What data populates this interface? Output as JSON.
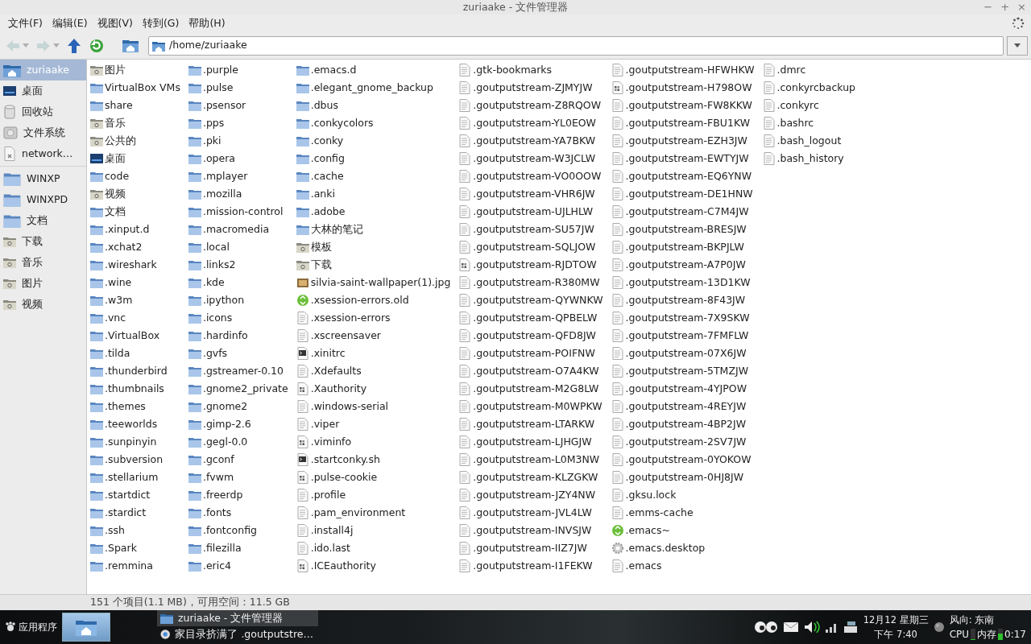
{
  "window": {
    "title": "zuriaake - 文件管理器",
    "controls": [
      "−",
      "+",
      "×"
    ]
  },
  "menu": [
    "文件(F)",
    "编辑(E)",
    "视图(V)",
    "转到(G)",
    "帮助(H)"
  ],
  "toolbar": [
    {
      "kind": "back",
      "disabled": true
    },
    {
      "kind": "forward",
      "disabled": true
    },
    {
      "kind": "up",
      "disabled": false
    },
    {
      "kind": "reload",
      "disabled": false
    },
    {
      "kind": "home",
      "disabled": false
    }
  ],
  "location": {
    "value": "/home/zuriaake"
  },
  "sidebar": {
    "groups": [
      [
        {
          "label": "zuriaake",
          "kind": "home",
          "selected": true
        },
        {
          "label": "桌面",
          "kind": "desktop",
          "selected": false
        },
        {
          "label": "回收站",
          "kind": "trash",
          "selected": false
        },
        {
          "label": "文件系统",
          "kind": "drive",
          "selected": false
        },
        {
          "label": "network…",
          "kind": "network",
          "selected": false
        }
      ],
      [
        {
          "label": "WINXP",
          "kind": "folder",
          "selected": false
        },
        {
          "label": "WINXPD",
          "kind": "folder",
          "selected": false
        },
        {
          "label": "文档",
          "kind": "folder",
          "selected": false
        },
        {
          "label": "下载",
          "kind": "special",
          "selected": false
        },
        {
          "label": "音乐",
          "kind": "special",
          "selected": false
        },
        {
          "label": "图片",
          "kind": "special",
          "selected": false
        },
        {
          "label": "视频",
          "kind": "special",
          "selected": false
        }
      ]
    ]
  },
  "files": [
    {
      "name": "图片",
      "kind": "special"
    },
    {
      "name": "VirtualBox VMs",
      "kind": "folder"
    },
    {
      "name": "share",
      "kind": "folder"
    },
    {
      "name": "音乐",
      "kind": "special"
    },
    {
      "name": "公共的",
      "kind": "special"
    },
    {
      "name": "桌面",
      "kind": "desktop"
    },
    {
      "name": "code",
      "kind": "folder"
    },
    {
      "name": "视频",
      "kind": "special"
    },
    {
      "name": "文档",
      "kind": "folder"
    },
    {
      "name": ".xinput.d",
      "kind": "folder"
    },
    {
      "name": ".xchat2",
      "kind": "folder"
    },
    {
      "name": ".wireshark",
      "kind": "folder"
    },
    {
      "name": ".wine",
      "kind": "folder"
    },
    {
      "name": ".w3m",
      "kind": "folder"
    },
    {
      "name": ".vnc",
      "kind": "folder"
    },
    {
      "name": ".VirtualBox",
      "kind": "folder"
    },
    {
      "name": ".tilda",
      "kind": "folder"
    },
    {
      "name": ".thunderbird",
      "kind": "folder"
    },
    {
      "name": ".thumbnails",
      "kind": "folder"
    },
    {
      "name": ".themes",
      "kind": "folder"
    },
    {
      "name": ".teeworlds",
      "kind": "folder"
    },
    {
      "name": ".sunpinyin",
      "kind": "folder"
    },
    {
      "name": ".subversion",
      "kind": "folder"
    },
    {
      "name": ".stellarium",
      "kind": "folder"
    },
    {
      "name": ".startdict",
      "kind": "folder"
    },
    {
      "name": ".stardict",
      "kind": "folder"
    },
    {
      "name": ".ssh",
      "kind": "folder"
    },
    {
      "name": ".Spark",
      "kind": "folder"
    },
    {
      "name": ".remmina",
      "kind": "folder"
    },
    {
      "name": ".purple",
      "kind": "folder"
    },
    {
      "name": ".pulse",
      "kind": "folder"
    },
    {
      "name": ".psensor",
      "kind": "folder"
    },
    {
      "name": ".pps",
      "kind": "folder"
    },
    {
      "name": ".pki",
      "kind": "folder"
    },
    {
      "name": ".opera",
      "kind": "folder"
    },
    {
      "name": ".mplayer",
      "kind": "folder"
    },
    {
      "name": ".mozilla",
      "kind": "folder"
    },
    {
      "name": ".mission-control",
      "kind": "folder"
    },
    {
      "name": ".macromedia",
      "kind": "folder"
    },
    {
      "name": ".local",
      "kind": "folder"
    },
    {
      "name": ".links2",
      "kind": "folder"
    },
    {
      "name": ".kde",
      "kind": "folder"
    },
    {
      "name": ".ipython",
      "kind": "folder"
    },
    {
      "name": ".icons",
      "kind": "folder"
    },
    {
      "name": ".hardinfo",
      "kind": "folder"
    },
    {
      "name": ".gvfs",
      "kind": "folder"
    },
    {
      "name": ".gstreamer-0.10",
      "kind": "folder"
    },
    {
      "name": ".gnome2_private",
      "kind": "folder"
    },
    {
      "name": ".gnome2",
      "kind": "folder"
    },
    {
      "name": ".gimp-2.6",
      "kind": "folder"
    },
    {
      "name": ".gegl-0.0",
      "kind": "folder"
    },
    {
      "name": ".gconf",
      "kind": "folder"
    },
    {
      "name": ".fvwm",
      "kind": "folder"
    },
    {
      "name": ".freerdp",
      "kind": "folder"
    },
    {
      "name": ".fonts",
      "kind": "folder"
    },
    {
      "name": ".fontconfig",
      "kind": "folder"
    },
    {
      "name": ".filezilla",
      "kind": "folder"
    },
    {
      "name": ".eric4",
      "kind": "folder"
    },
    {
      "name": ".emacs.d",
      "kind": "folder"
    },
    {
      "name": ".elegant_gnome_backup",
      "kind": "folder"
    },
    {
      "name": ".dbus",
      "kind": "folder"
    },
    {
      "name": ".conkycolors",
      "kind": "folder"
    },
    {
      "name": ".conky",
      "kind": "folder"
    },
    {
      "name": ".config",
      "kind": "folder"
    },
    {
      "name": ".cache",
      "kind": "folder"
    },
    {
      "name": ".anki",
      "kind": "folder"
    },
    {
      "name": ".adobe",
      "kind": "folder"
    },
    {
      "name": "大林的笔记",
      "kind": "folder"
    },
    {
      "name": "模板",
      "kind": "special"
    },
    {
      "name": "下载",
      "kind": "special"
    },
    {
      "name": "silvia-saint-wallpaper(1).jpg",
      "kind": "image"
    },
    {
      "name": ".xsession-errors.old",
      "kind": "backup"
    },
    {
      "name": ".xsession-errors",
      "kind": "text"
    },
    {
      "name": ".xscreensaver",
      "kind": "text"
    },
    {
      "name": ".xinitrc",
      "kind": "script"
    },
    {
      "name": ".Xdefaults",
      "kind": "text"
    },
    {
      "name": ".Xauthority",
      "kind": "data"
    },
    {
      "name": ".windows-serial",
      "kind": "text"
    },
    {
      "name": ".viper",
      "kind": "text"
    },
    {
      "name": ".viminfo",
      "kind": "data"
    },
    {
      "name": ".startconky.sh",
      "kind": "script"
    },
    {
      "name": ".pulse-cookie",
      "kind": "data"
    },
    {
      "name": ".profile",
      "kind": "text"
    },
    {
      "name": ".pam_environment",
      "kind": "text"
    },
    {
      "name": ".install4j",
      "kind": "text"
    },
    {
      "name": ".ido.last",
      "kind": "text"
    },
    {
      "name": ".ICEauthority",
      "kind": "data"
    },
    {
      "name": ".gtk-bookmarks",
      "kind": "text"
    },
    {
      "name": ".goutputstream-ZJMYJW",
      "kind": "text"
    },
    {
      "name": ".goutputstream-Z8RQOW",
      "kind": "text"
    },
    {
      "name": ".goutputstream-YL0EOW",
      "kind": "text"
    },
    {
      "name": ".goutputstream-YA7BKW",
      "kind": "text"
    },
    {
      "name": ".goutputstream-W3JCLW",
      "kind": "text"
    },
    {
      "name": ".goutputstream-VO0OOW",
      "kind": "text"
    },
    {
      "name": ".goutputstream-VHR6JW",
      "kind": "text"
    },
    {
      "name": ".goutputstream-UJLHLW",
      "kind": "text"
    },
    {
      "name": ".goutputstream-SU57JW",
      "kind": "text"
    },
    {
      "name": ".goutputstream-SQLJOW",
      "kind": "text"
    },
    {
      "name": ".goutputstream-RJDTOW",
      "kind": "data"
    },
    {
      "name": ".goutputstream-R380MW",
      "kind": "text"
    },
    {
      "name": ".goutputstream-QYWNKW",
      "kind": "text"
    },
    {
      "name": ".goutputstream-QPBELW",
      "kind": "text"
    },
    {
      "name": ".goutputstream-QFD8JW",
      "kind": "text"
    },
    {
      "name": ".goutputstream-POIFNW",
      "kind": "text"
    },
    {
      "name": ".goutputstream-O7A4KW",
      "kind": "text"
    },
    {
      "name": ".goutputstream-M2G8LW",
      "kind": "text"
    },
    {
      "name": ".goutputstream-M0WPKW",
      "kind": "text"
    },
    {
      "name": ".goutputstream-LTARKW",
      "kind": "text"
    },
    {
      "name": ".goutputstream-LJHGJW",
      "kind": "text"
    },
    {
      "name": ".goutputstream-L0M3NW",
      "kind": "text"
    },
    {
      "name": ".goutputstream-KLZGKW",
      "kind": "text"
    },
    {
      "name": ".goutputstream-JZY4NW",
      "kind": "text"
    },
    {
      "name": ".goutputstream-JVL4LW",
      "kind": "text"
    },
    {
      "name": ".goutputstream-INVSJW",
      "kind": "text"
    },
    {
      "name": ".goutputstream-IIZ7JW",
      "kind": "text"
    },
    {
      "name": ".goutputstream-I1FEKW",
      "kind": "text"
    },
    {
      "name": ".goutputstream-HFWHKW",
      "kind": "text"
    },
    {
      "name": ".goutputstream-H798OW",
      "kind": "data"
    },
    {
      "name": ".goutputstream-FW8KKW",
      "kind": "text"
    },
    {
      "name": ".goutputstream-FBU1KW",
      "kind": "text"
    },
    {
      "name": ".goutputstream-EZH3JW",
      "kind": "text"
    },
    {
      "name": ".goutputstream-EWTYJW",
      "kind": "text"
    },
    {
      "name": ".goutputstream-EQ6YNW",
      "kind": "text"
    },
    {
      "name": ".goutputstream-DE1HNW",
      "kind": "text"
    },
    {
      "name": ".goutputstream-C7M4JW",
      "kind": "text"
    },
    {
      "name": ".goutputstream-BRESJW",
      "kind": "text"
    },
    {
      "name": ".goutputstream-BKPJLW",
      "kind": "text"
    },
    {
      "name": ".goutputstream-A7P0JW",
      "kind": "text"
    },
    {
      "name": ".goutputstream-13D1KW",
      "kind": "text"
    },
    {
      "name": ".goutputstream-8F43JW",
      "kind": "text"
    },
    {
      "name": ".goutputstream-7X9SKW",
      "kind": "text"
    },
    {
      "name": ".goutputstream-7FMFLW",
      "kind": "text"
    },
    {
      "name": ".goutputstream-07X6JW",
      "kind": "text"
    },
    {
      "name": ".goutputstream-5TMZJW",
      "kind": "text"
    },
    {
      "name": ".goutputstream-4YJPOW",
      "kind": "text"
    },
    {
      "name": ".goutputstream-4REYJW",
      "kind": "text"
    },
    {
      "name": ".goutputstream-4BP2JW",
      "kind": "text"
    },
    {
      "name": ".goutputstream-2SV7JW",
      "kind": "text"
    },
    {
      "name": ".goutputstream-0YOKOW",
      "kind": "text"
    },
    {
      "name": ".goutputstream-0HJ8JW",
      "kind": "text"
    },
    {
      "name": ".gksu.lock",
      "kind": "text"
    },
    {
      "name": ".emms-cache",
      "kind": "text"
    },
    {
      "name": ".emacs~",
      "kind": "backup"
    },
    {
      "name": ".emacs.desktop",
      "kind": "settings"
    },
    {
      "name": ".emacs",
      "kind": "text"
    },
    {
      "name": ".dmrc",
      "kind": "text"
    },
    {
      "name": ".conkyrcbackup",
      "kind": "text"
    },
    {
      "name": ".conkyrc",
      "kind": "text"
    },
    {
      "name": ".bashrc",
      "kind": "text"
    },
    {
      "name": ".bash_logout",
      "kind": "text"
    },
    {
      "name": ".bash_history",
      "kind": "text"
    }
  ],
  "status_bar": "151 个项目(1.1 MB)，可用空间：11.5 GB",
  "taskbar": {
    "apps_menu": "应用程序",
    "tasks": [
      {
        "label": "zuriaake - 文件管理器",
        "kind": "files",
        "selected": true
      },
      {
        "label": "家目录挤满了 .goutputstre…",
        "kind": "browser",
        "selected": false
      }
    ],
    "date": "12月12 星期三",
    "time": "下午 7:40",
    "weather": "风向: 东南",
    "cpu": {
      "label": "CPU",
      "level": 0.05
    },
    "memory": {
      "label": "内存",
      "level": 0.55
    },
    "uptime": "0:17"
  }
}
